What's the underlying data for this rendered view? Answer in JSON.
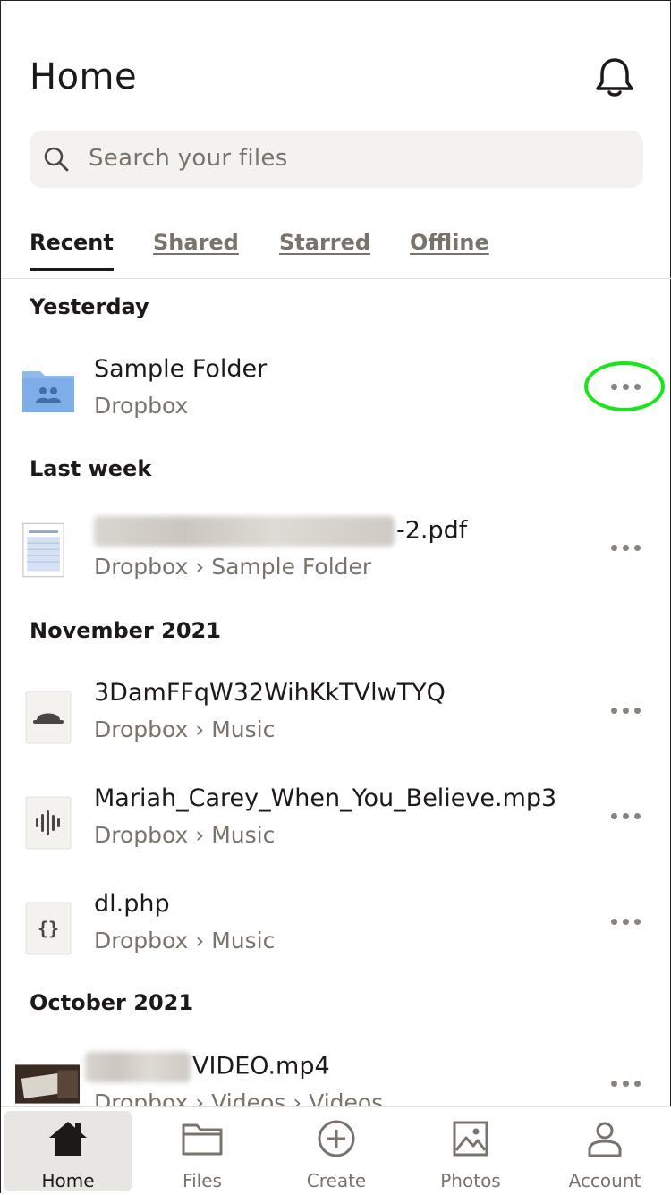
{
  "header": {
    "title": "Home"
  },
  "search": {
    "placeholder": "Search your files"
  },
  "tabs": [
    {
      "label": "Recent",
      "active": true
    },
    {
      "label": "Shared",
      "active": false
    },
    {
      "label": "Starred",
      "active": false
    },
    {
      "label": "Offline",
      "active": false
    }
  ],
  "sections": {
    "yesterday": "Yesterday",
    "last_week": "Last week",
    "november": "November 2021",
    "october": "October 2021"
  },
  "files": [
    {
      "name": "Sample Folder",
      "path": "Dropbox",
      "icon": "shared-folder-icon"
    },
    {
      "name": "-2.pdf",
      "path": "Dropbox › Sample Folder",
      "icon": "pdf-thumbnail"
    },
    {
      "name": "3DamFFqW32WihKkTVlwTYQ",
      "path": "Dropbox › Music",
      "icon": "unknown-file-icon"
    },
    {
      "name": "Mariah_Carey_When_You_Believe.mp3",
      "path": "Dropbox › Music",
      "icon": "audio-file-icon"
    },
    {
      "name": "dl.php",
      "path": "Dropbox › Music",
      "icon": "code-file-icon"
    },
    {
      "name": "VIDEO.mp4",
      "path": "Dropbox › Videos › Videos",
      "icon": "video-thumbnail"
    }
  ],
  "bottom_nav": [
    {
      "label": "Home",
      "icon": "home-icon",
      "active": true
    },
    {
      "label": "Files",
      "icon": "folder-icon",
      "active": false
    },
    {
      "label": "Create",
      "icon": "plus-circle-icon",
      "active": false
    },
    {
      "label": "Photos",
      "icon": "photo-icon",
      "active": false
    },
    {
      "label": "Account",
      "icon": "person-icon",
      "active": false
    }
  ],
  "colors": {
    "accent_blue": "#6ea9e8",
    "highlight_ring": "#19e619",
    "text_secondary": "#7a736b"
  }
}
